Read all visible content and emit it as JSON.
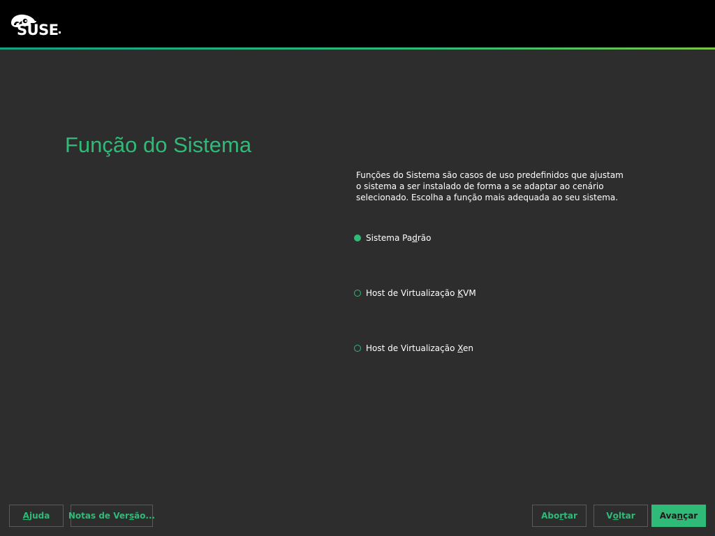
{
  "header": {
    "logo_text": "SUSE"
  },
  "main": {
    "title": "Função do Sistema",
    "description": "Funções do Sistema são casos de uso predefinidos que ajustam o sistema a ser instalado de forma a se adaptar ao cenário selecionado. Escolha a função mais adequada ao seu sistema.",
    "roles": [
      {
        "pre": "Sistema Pa",
        "key": "d",
        "post": "rão",
        "selected": true
      },
      {
        "pre": "Host de Virtualização ",
        "key": "K",
        "post": "VM",
        "selected": false
      },
      {
        "pre": "Host de Virtualização ",
        "key": "X",
        "post": "en",
        "selected": false
      }
    ]
  },
  "footer": {
    "help": {
      "key": "A",
      "post": "juda"
    },
    "release_notes": {
      "pre": "Notas de Ver",
      "key": "s",
      "post": "ão..."
    },
    "abort": {
      "pre": "Abo",
      "key": "r",
      "post": "tar"
    },
    "back": {
      "pre": "V",
      "key": "o",
      "post": "ltar"
    },
    "next": {
      "pre": "Ava",
      "key": "n",
      "post": "çar"
    }
  },
  "colors": {
    "accent": "#30ba78",
    "background": "#2d2d2d",
    "header": "#000000"
  }
}
